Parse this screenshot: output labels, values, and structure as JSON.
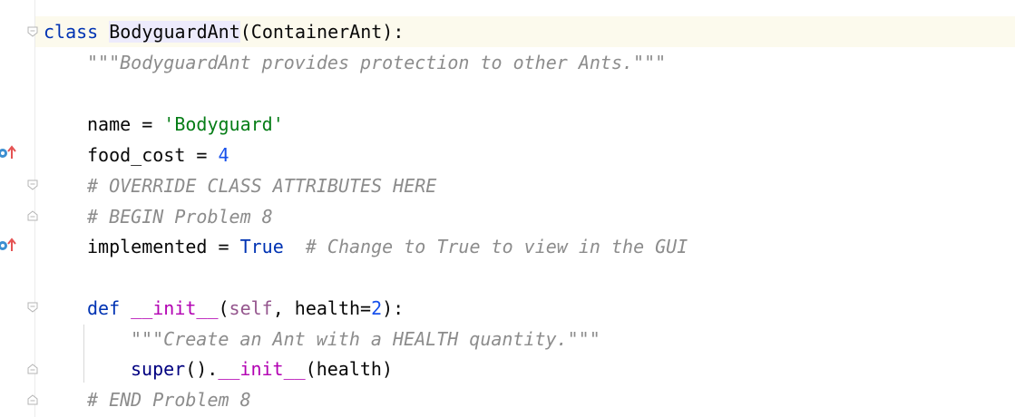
{
  "code": {
    "l1": {
      "kw": "class",
      "name": "BodyguardAnt",
      "rest": "(ContainerAnt):"
    },
    "l2": {
      "doc": "\"\"\"BodyguardAnt provides protection to other Ants.\"\"\""
    },
    "l4": {
      "lhs": "name = ",
      "str": "'Bodyguard'"
    },
    "l5": {
      "lhs": "food_cost = ",
      "num": "4"
    },
    "l6": {
      "cmt": "# OVERRIDE CLASS ATTRIBUTES HERE"
    },
    "l7": {
      "cmt": "# BEGIN Problem 8"
    },
    "l8": {
      "lhs": "implemented = ",
      "val": "True",
      "cmt": "  # Change to True to view in the GUI"
    },
    "l10": {
      "kw": "def ",
      "fn": "__init__",
      "p1": "(",
      "self": "self",
      "p2": ", health=",
      "num": "2",
      "p3": "):"
    },
    "l11": {
      "doc": "\"\"\"Create an Ant with a HEALTH quantity.\"\"\""
    },
    "l12": {
      "sup": "super",
      "p1": "().",
      "fn": "__init__",
      "p2": "(health)"
    },
    "l13": {
      "cmt": "# END Problem 8"
    }
  },
  "gutter_icons": [
    "override-marker-icon",
    "override-marker-icon"
  ],
  "colors": {
    "keyword": "#0033b3",
    "string": "#067d17",
    "comment": "#8c8c8c",
    "number": "#1750eb",
    "dunder": "#b200b2",
    "caret_line": "#fcfaed"
  }
}
